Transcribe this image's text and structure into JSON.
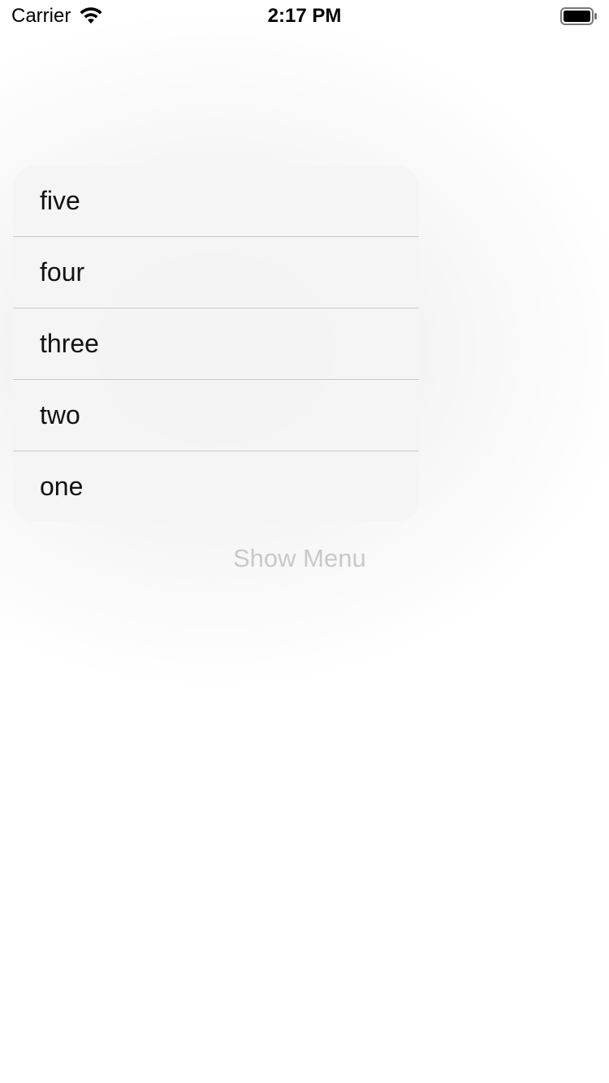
{
  "status_bar": {
    "carrier": "Carrier",
    "time": "2:17 PM",
    "icons": [
      "wifi-icon",
      "battery-icon"
    ]
  },
  "menu": {
    "items": [
      {
        "label": "five"
      },
      {
        "label": "four"
      },
      {
        "label": "three"
      },
      {
        "label": "two"
      },
      {
        "label": "one"
      }
    ]
  },
  "button": {
    "label": "Show Menu",
    "color": "#c9c9c9"
  },
  "colors": {
    "menu_background": "#f4f4f4",
    "separator": "#c8c8c8",
    "text": "#111111"
  }
}
